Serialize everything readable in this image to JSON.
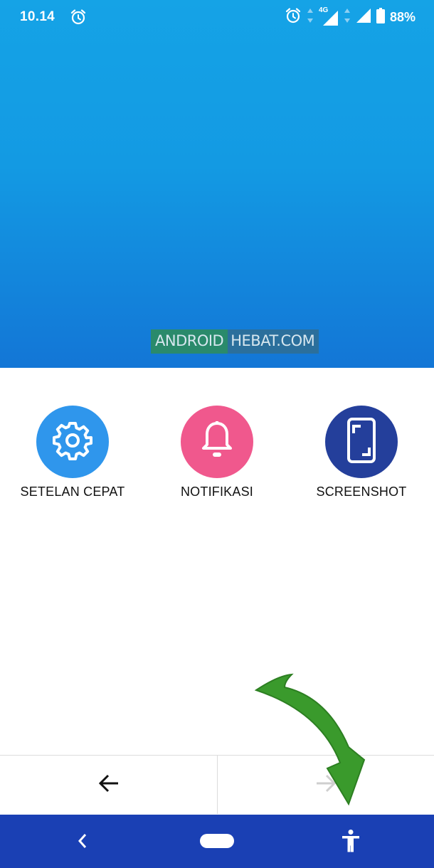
{
  "status_bar": {
    "time": "10.14",
    "network": "4G",
    "battery": "88%"
  },
  "watermark": {
    "part1": "ANDROID",
    "part2": "HEBAT.COM"
  },
  "actions": [
    {
      "label": "SETELAN CEPAT",
      "icon": "gear-icon",
      "color": "#2f96ec"
    },
    {
      "label": "NOTIFIKASI",
      "icon": "bell-icon",
      "color": "#f0588d"
    },
    {
      "label": "SCREENSHOT",
      "icon": "screenshot-icon",
      "color": "#243f9b"
    }
  ],
  "colors": {
    "system_nav": "#1a40b4",
    "annotation_arrow": "#3a9a2c"
  }
}
